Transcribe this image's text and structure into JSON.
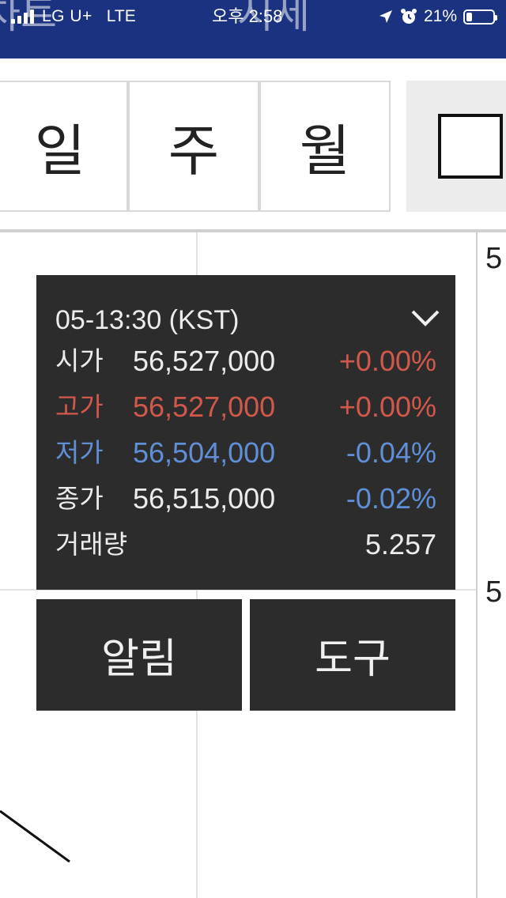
{
  "status_bar": {
    "carrier": "LG U+",
    "network": "LTE",
    "time": "오후 2:58",
    "battery_percent": "21%",
    "battery_level": 0.21,
    "icons": [
      "signal-icon",
      "location-arrow-icon",
      "alarm-clock-icon",
      "battery-icon"
    ],
    "background": "#1b3281"
  },
  "header": {
    "cut_left_text": "차트",
    "cut_right_text": "시세"
  },
  "period_tabs": [
    {
      "label": "일"
    },
    {
      "label": "주"
    },
    {
      "label": "월"
    }
  ],
  "chart": {
    "axis_labels": [
      "5",
      "5"
    ]
  },
  "tooltip": {
    "time": "05-13:30 (KST)",
    "rows": [
      {
        "label": "시가",
        "value": "56,527,000",
        "change": "+0.00%"
      },
      {
        "label": "고가",
        "value": "56,527,000",
        "change": "+0.00%"
      },
      {
        "label": "저가",
        "value": "56,504,000",
        "change": "-0.04%"
      },
      {
        "label": "종가",
        "value": "56,515,000",
        "change": "-0.02%"
      },
      {
        "label": "거래량",
        "value": "",
        "change": "5.257"
      }
    ],
    "colors": {
      "up": "#d2584c",
      "down": "#5f8fd6",
      "neutral": "#ececec"
    }
  },
  "buttons": {
    "alarm": "알림",
    "tools": "도구"
  }
}
